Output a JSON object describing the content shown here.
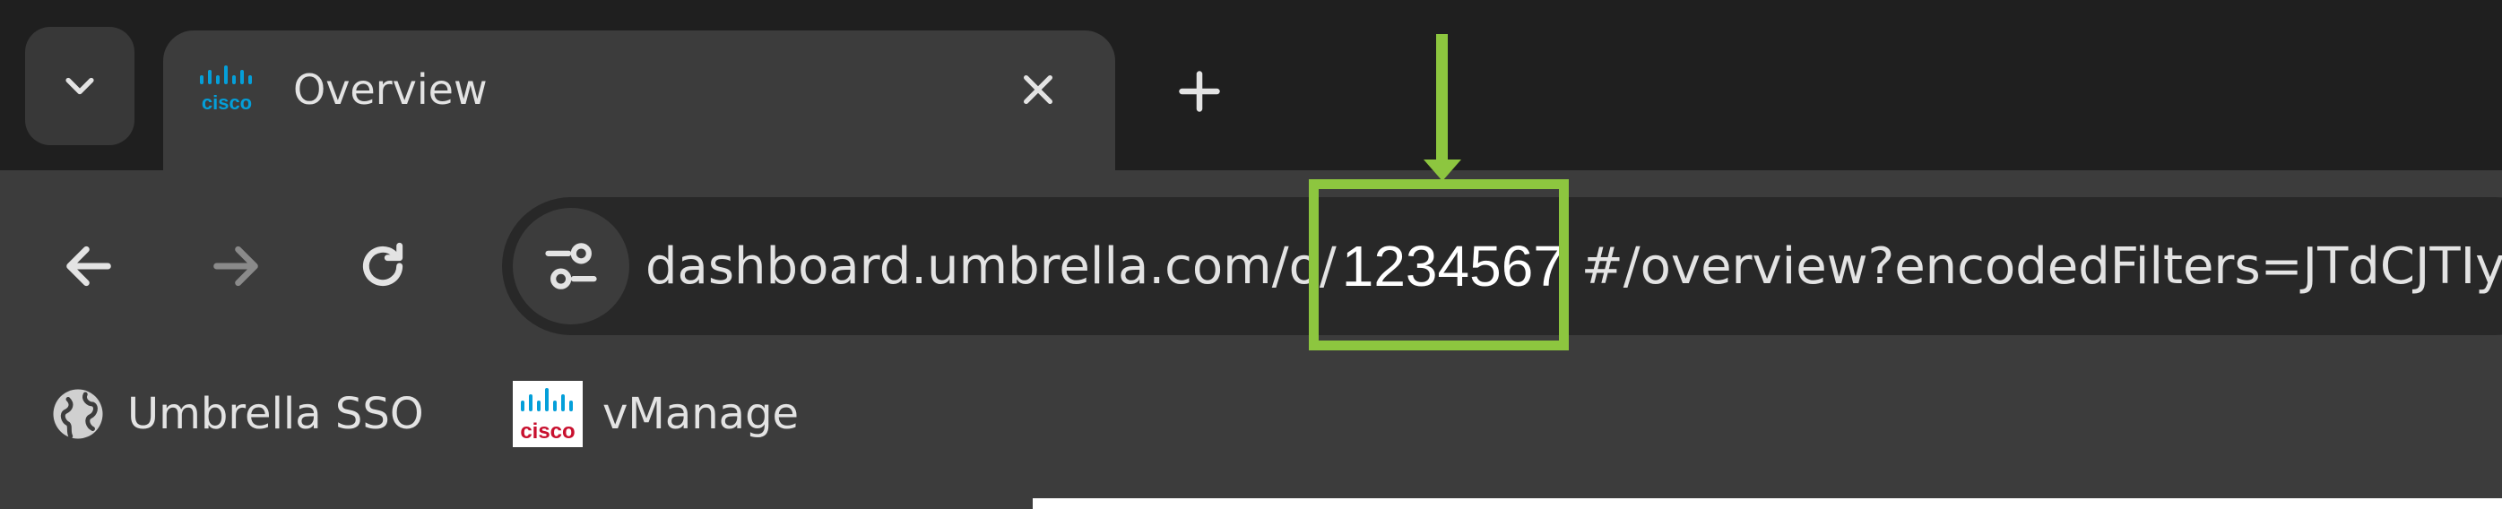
{
  "tab": {
    "title": "Overview",
    "favicon": "cisco-logo-icon"
  },
  "toolbar": {
    "back_icon": "arrow-left-icon",
    "forward_icon": "arrow-right-icon",
    "reload_icon": "reload-icon",
    "site_info_icon": "tune-icon"
  },
  "address_bar": {
    "url_prefix": "dashboard.umbrella.com/o/",
    "highlighted_id": "1234567",
    "url_suffix": "#/overview?encodedFilters=JTdCJTIy"
  },
  "bookmarks": [
    {
      "label": "Umbrella SSO",
      "icon": "globe-icon"
    },
    {
      "label": "vManage",
      "icon": "cisco-logo-icon"
    }
  ],
  "annotation": {
    "color": "#8dc63f"
  },
  "colors": {
    "frame": "#1f1f1f",
    "toolbar": "#3c3c3c",
    "omnibox": "#282828",
    "text": "#e3e3e3",
    "cisco_blue": "#049fd9"
  }
}
